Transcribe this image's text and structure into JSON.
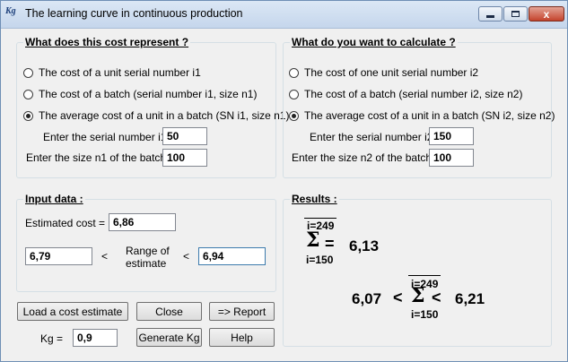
{
  "window": {
    "icon_text": "Kg",
    "title": "The learning curve in continuous production",
    "close_glyph": "x"
  },
  "left_group": {
    "title": "What does this cost represent ?",
    "options": [
      {
        "label": "The cost of a unit serial number i1",
        "selected": false
      },
      {
        "label": "The cost of a batch (serial number i1, size n1)",
        "selected": false
      },
      {
        "label": "The average cost of a unit in a batch (SN i1, size n1)",
        "selected": true
      }
    ],
    "serial_label": "Enter the serial number i1 :",
    "serial_value": "50",
    "size_label": "Enter the size n1 of the batch :",
    "size_value": "100"
  },
  "right_group": {
    "title": "What do you want to calculate ?",
    "options": [
      {
        "label": "The cost of one unit serial number i2",
        "selected": false
      },
      {
        "label": "The cost of a batch (serial number i2, size n2)",
        "selected": false
      },
      {
        "label": "The average cost of a unit in a batch (SN i2, size n2)",
        "selected": true
      }
    ],
    "serial_label": "Enter the serial number i2 :",
    "serial_value": "150",
    "size_label": "Enter the size n2 of the batch :",
    "size_value": "100"
  },
  "input_group": {
    "title": "Input data :",
    "estimated_cost_label": "Estimated cost =",
    "estimated_cost_value": "6,86",
    "lower_value": "6,79",
    "less_than_1": "<",
    "range_label_line1": "Range of",
    "range_label_line2": "estimate",
    "less_than_2": "<",
    "upper_value": "6,94"
  },
  "results_group": {
    "title": "Results :",
    "sum_upper": "i=249",
    "sum_lower": "i=150",
    "sum_symbol": "Σ",
    "equals": "=",
    "result_value": "6,13",
    "range_low": "6,07",
    "range_high": "6,21",
    "range_upper": "i=249",
    "range_lower": "i=150",
    "lt": "<"
  },
  "buttons": {
    "load": "Load a cost estimate",
    "close": "Close",
    "report": "=> Report",
    "generate": "Generate Kg",
    "help": "Help"
  },
  "kg": {
    "label": "Kg =",
    "value": "0,9"
  }
}
